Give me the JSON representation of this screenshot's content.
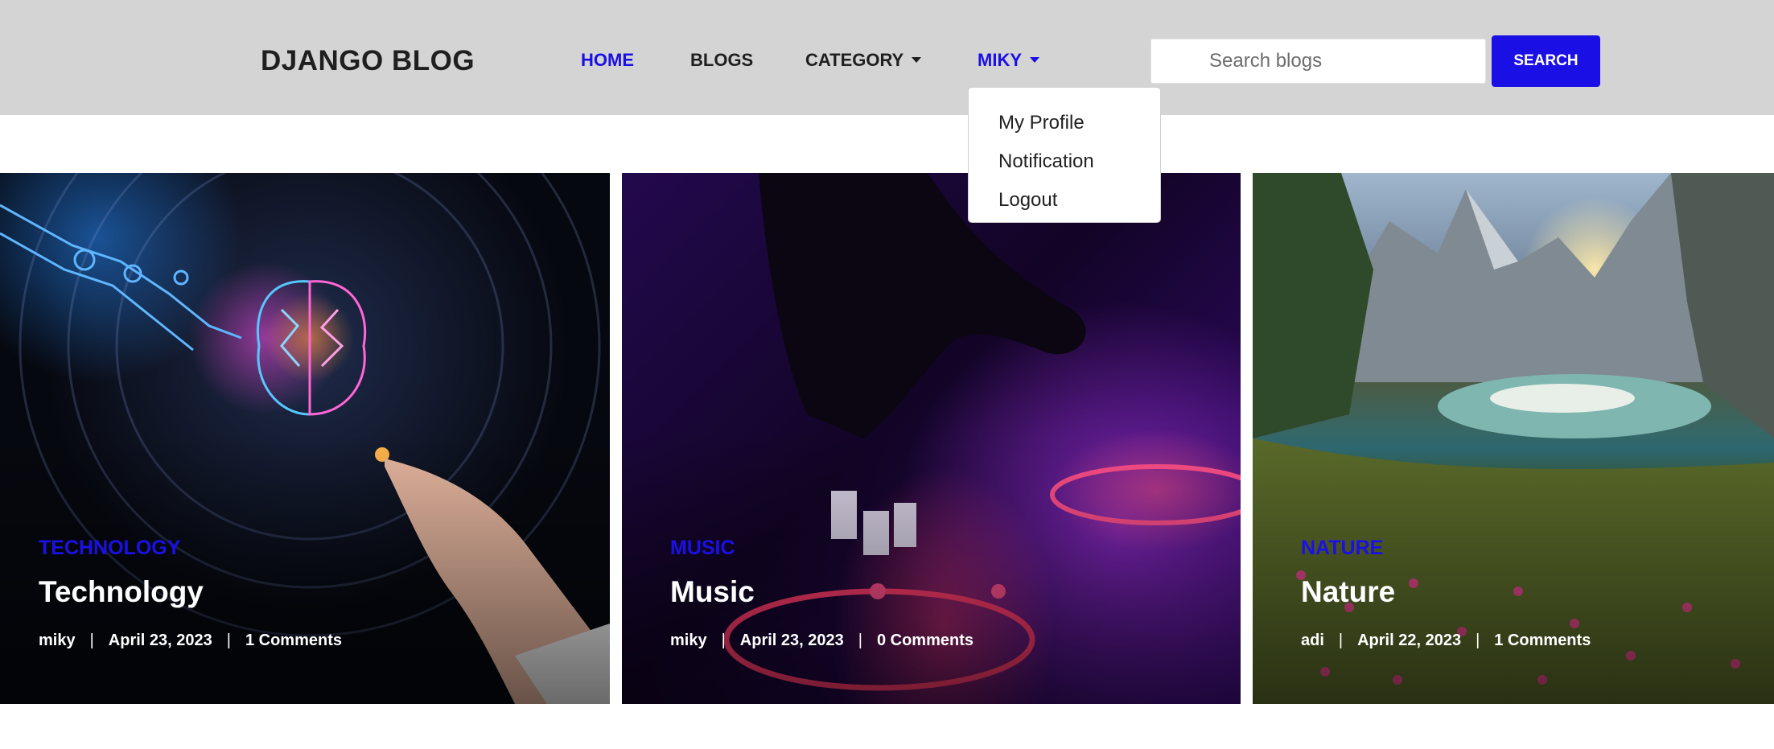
{
  "header": {
    "brand": "DJANGO BLOG",
    "nav": [
      {
        "label": "HOME"
      },
      {
        "label": "BLOGS"
      },
      {
        "label": "CATEGORY"
      },
      {
        "label": "MIKY"
      }
    ],
    "search": {
      "placeholder": "Search blogs",
      "button_label": "SEARCH"
    }
  },
  "user_menu": {
    "items": [
      "My Profile",
      "Notification",
      "Logout"
    ]
  },
  "posts": [
    {
      "category": "TECHNOLOGY",
      "title": "Technology",
      "author": "miky",
      "date": "April 23, 2023",
      "comments": "1 Comments",
      "image": "ai-brain-robot-hand-image"
    },
    {
      "category": "MUSIC",
      "title": "Music",
      "author": "miky",
      "date": "April 23, 2023",
      "comments": "0 Comments",
      "image": "dj-turntable-image"
    },
    {
      "category": "NATURE",
      "title": "Nature",
      "author": "adi",
      "date": "April 22, 2023",
      "comments": "1 Comments",
      "image": "mountain-lake-flowers-image"
    }
  ],
  "colors": {
    "accent": "#1a10e6",
    "header_bg": "#d4d4d4"
  }
}
